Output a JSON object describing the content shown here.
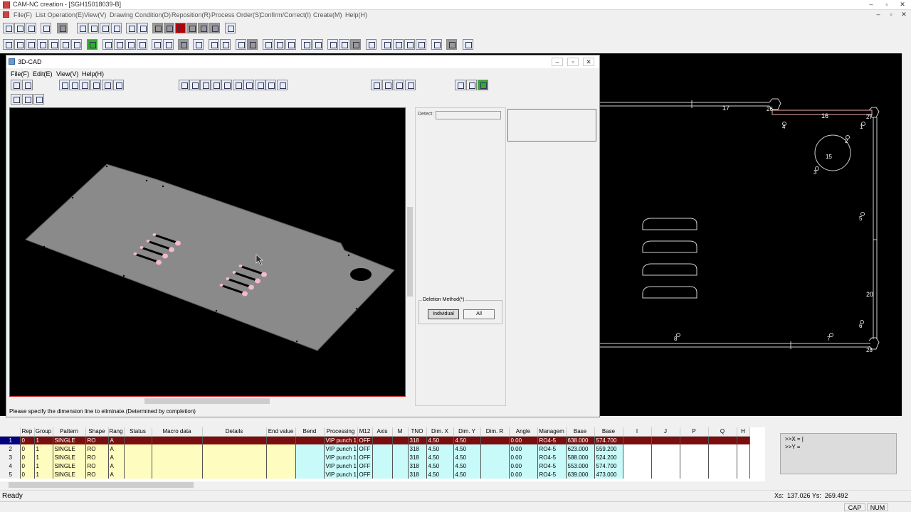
{
  "app": {
    "title": "CAM-NC creation - [SGH15018039-B]"
  },
  "menu": [
    "File(F)",
    "List Operation(E)",
    "View(V)",
    "Drawing Condition(D)",
    "Reposition(R)",
    "Process Order(S)",
    "Confirm/Correct(I)",
    "Create(M)",
    "Help(H)"
  ],
  "cad_window": {
    "title": "3D-CAD",
    "menu": [
      "File(F)",
      "Edit(E)",
      "View(V)",
      "Help(H)"
    ],
    "detect_label": "Detect:",
    "deletion_method_label": "Deletion Method(*)",
    "deletion_buttons": [
      "Individual",
      "All"
    ],
    "status_message": "Please specify the dimension line to eliminate.(Determined by completion)"
  },
  "drawing_labels": {
    "l17": "17",
    "l26": "26",
    "l16": "16",
    "l27": "27",
    "l4": "4",
    "l1": "1",
    "l2": "2",
    "l15": "15",
    "l3": "3",
    "l5": "5",
    "l20": "20",
    "l6": "6",
    "l8": "8",
    "l7": "7",
    "l28": "28"
  },
  "grid": {
    "columns": [
      "",
      "Rep",
      "Group",
      "Pattern",
      "Shape",
      "Rang",
      "Status",
      "Macro data",
      "Details",
      "End value",
      "Bend",
      "Processing",
      "M12",
      "Axis",
      "M",
      "TNO",
      "Dim. X",
      "Dim. Y",
      "Dim. R",
      "Angle",
      "Managem",
      "Base",
      "Base",
      "I",
      "J",
      "P",
      "Q",
      "H"
    ],
    "rows": [
      [
        "1",
        "0",
        "1",
        "SINGLE",
        "RO",
        "A",
        "",
        "",
        "",
        "",
        "",
        "VIP punch 1",
        "OFF",
        "",
        "",
        "318",
        "4.50",
        "4.50",
        "",
        "0.00",
        "RO4-5",
        "638.000",
        "574.700",
        "",
        "",
        "",
        "",
        ""
      ],
      [
        "2",
        "0",
        "1",
        "SINGLE",
        "RO",
        "A",
        "",
        "",
        "",
        "",
        "",
        "VIP punch 1",
        "OFF",
        "",
        "",
        "318",
        "4.50",
        "4.50",
        "",
        "0.00",
        "RO4-5",
        "623.000",
        "559.200",
        "",
        "",
        "",
        "",
        ""
      ],
      [
        "3",
        "0",
        "1",
        "SINGLE",
        "RO",
        "A",
        "",
        "",
        "",
        "",
        "",
        "VIP punch 1",
        "OFF",
        "",
        "",
        "318",
        "4.50",
        "4.50",
        "",
        "0.00",
        "RO4-5",
        "588.000",
        "524.200",
        "",
        "",
        "",
        "",
        ""
      ],
      [
        "4",
        "0",
        "1",
        "SINGLE",
        "RO",
        "A",
        "",
        "",
        "",
        "",
        "",
        "VIP punch 1",
        "OFF",
        "",
        "",
        "318",
        "4.50",
        "4.50",
        "",
        "0.00",
        "RO4-5",
        "553.000",
        "574.700",
        "",
        "",
        "",
        "",
        ""
      ],
      [
        "5",
        "0",
        "1",
        "SINGLE",
        "RO",
        "A",
        "",
        "",
        "",
        "",
        "",
        "VIP punch 1",
        "OFF",
        "",
        "",
        "318",
        "4.50",
        "4.50",
        "",
        "0.00",
        "RO4-5",
        "639.000",
        "473.000",
        "",
        "",
        "",
        "",
        ""
      ]
    ]
  },
  "coords": {
    "x_line": ">>X = |",
    "y_line": ">>Y ="
  },
  "status": {
    "text": "Ready",
    "coords": "Xs:  137.026 Ys:  269.492",
    "cap": "CAP",
    "num": "NUM"
  },
  "colors": {
    "selected_row": "#7a0d0d",
    "yellow_cell": "#fffcbf",
    "cyan_cell": "#c8fafa",
    "part_gray": "#8a8a8a",
    "dim_line": "#f0b0b0"
  }
}
